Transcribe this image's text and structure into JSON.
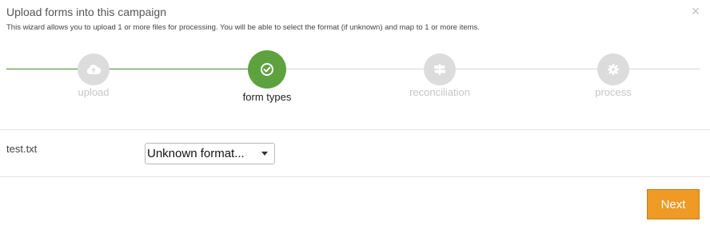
{
  "dialog": {
    "title": "Upload forms into this campaign",
    "subtitle": "This wizard allows you to upload 1 or more files for processing. You will be able to select the format (if unknown) and map to 1 or more items.",
    "close_glyph": "×"
  },
  "steps": [
    {
      "label": "upload",
      "icon": "cloud-upload-icon",
      "state": "done"
    },
    {
      "label": "form types",
      "icon": "check-circle-icon",
      "state": "active"
    },
    {
      "label": "reconciliation",
      "icon": "signpost-icon",
      "state": "pending"
    },
    {
      "label": "process",
      "icon": "gear-icon",
      "state": "pending"
    }
  ],
  "files": [
    {
      "name": "test.txt",
      "format_selected": "Unknown format..."
    }
  ],
  "footer": {
    "next_label": "Next"
  },
  "colors": {
    "active_step": "#5ea23f",
    "progress_line": "#3f8a34",
    "inactive_step": "#dcdcdc",
    "next_button": "#ee9a25"
  }
}
